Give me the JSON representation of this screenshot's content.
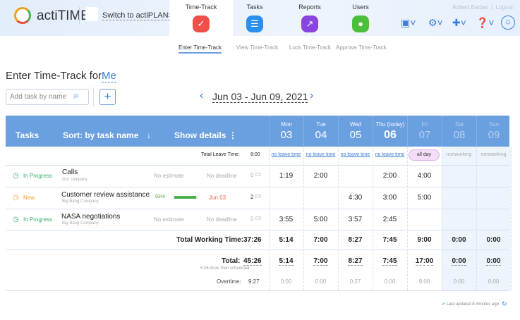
{
  "header": {
    "logo": "actiTIME",
    "switch": "Switch to actiPLANS",
    "user": "Robert Barber",
    "logout": "Logout",
    "tabs": [
      {
        "label": "Time-Track",
        "color": "#f0504a",
        "glyph": "✓"
      },
      {
        "label": "Tasks",
        "color": "#2b8ef0",
        "glyph": "☰"
      },
      {
        "label": "Reports",
        "color": "#8a44e0",
        "glyph": "↗"
      },
      {
        "label": "Users",
        "color": "#4cbf3a",
        "glyph": "●"
      }
    ]
  },
  "subnav": [
    "Enter Time-Track",
    "View Time-Track",
    "Lock Time-Track",
    "Approve Time-Track"
  ],
  "page": {
    "title": "Enter Time-Track for",
    "user": "Me",
    "search_placeholder": "Add task by name",
    "add": "+",
    "range": "Jun 03 - Jun 09, 2021",
    "prev": "‹",
    "next": "›"
  },
  "table": {
    "tasks_label": "Tasks",
    "sort_label": "Sort: by task name",
    "sort_icon": "↓",
    "details_label": "Show details",
    "details_icon": "⋮",
    "days": [
      {
        "name": "Mon",
        "date": "03"
      },
      {
        "name": "Tue",
        "date": "04"
      },
      {
        "name": "Wed",
        "date": "05"
      },
      {
        "name": "Thu (today)",
        "date": "06"
      },
      {
        "name": "Fri",
        "date": "07"
      },
      {
        "name": "Sat",
        "date": "08"
      },
      {
        "name": "Sun",
        "date": "09"
      }
    ],
    "leave_label": "Total Leave Time:",
    "leave_total": "8:00",
    "leave": [
      "no leave time",
      "no leave time",
      "no leave time",
      "no leave time",
      "all day",
      "nonworking",
      "nonworking"
    ],
    "rows": [
      {
        "status": "In Progress",
        "status_color": "#3aaa6a",
        "name": "Calls",
        "company": "Our company",
        "estimate": "No estimate",
        "deadline": "No deadline",
        "comments": "0",
        "times": [
          "1:19",
          "2:00",
          "",
          "2:00",
          "4:00",
          "",
          ""
        ]
      },
      {
        "status": "New",
        "status_color": "#f0a020",
        "name": "Customer review assistance",
        "company": "Big Bang Company",
        "progress": "93%",
        "progress_value": 93,
        "deadline": "Jun 03",
        "comments": "2",
        "times": [
          "",
          "",
          "4:30",
          "3:00",
          "5:00",
          "",
          ""
        ]
      },
      {
        "status": "In Progress",
        "status_color": "#3aaa6a",
        "name": "NASA negotiations",
        "company": "Big Bang Company",
        "estimate": "No estimate",
        "deadline": "No deadline",
        "comments": "0",
        "times": [
          "3:55",
          "5:00",
          "3:57",
          "2:45",
          "",
          "",
          ""
        ]
      }
    ],
    "working_label": "Total Working Time:",
    "working_total": "37:26",
    "working": [
      "5:14",
      "7:00",
      "8:27",
      "7:45",
      "9:00",
      "0:00",
      "0:00"
    ],
    "total_label": "Total:",
    "total": "45:26",
    "total_note": "5:26 more than scheduled",
    "totals": [
      "5:14",
      "7:00",
      "8:27",
      "7:45",
      "17:00",
      "0:00",
      "0:00"
    ],
    "overtime_label": "Overtime:",
    "overtime_total": "9:27",
    "overtime": [
      "0:00",
      "0:00",
      "0:27",
      "0:00",
      "9:00",
      "0:00",
      "0:00"
    ]
  },
  "footer": {
    "updated": "Last updated 8 minutes ago"
  }
}
